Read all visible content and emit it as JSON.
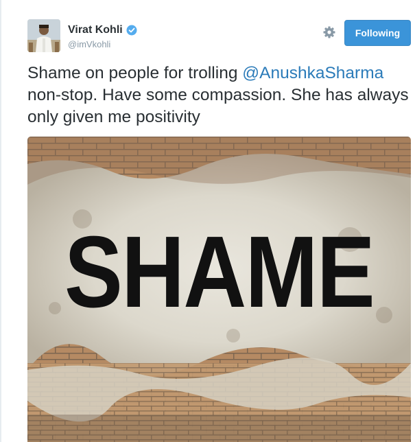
{
  "tweet": {
    "display_name": "Virat Kohli",
    "handle": "@imVkohli",
    "follow_button": "Following",
    "text_before": "Shame on people for trolling ",
    "mention": "@AnushkaSharma",
    "text_after": " non-stop. Have some compassion. She has always only given me positivity"
  },
  "media": {
    "overlay_text": "SHAME"
  },
  "icons": {
    "verified": "verified-badge-icon",
    "settings": "gear-icon"
  },
  "colors": {
    "follow_button_bg": "#3b94d9",
    "mention": "#2b7bb9",
    "verified": "#55acee",
    "handle": "#8899a6"
  }
}
